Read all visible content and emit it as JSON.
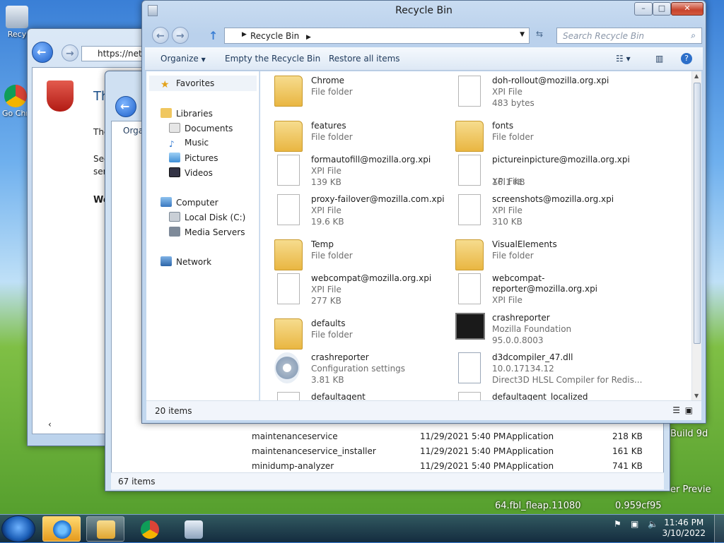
{
  "desktop": {
    "icons": [
      {
        "label": "Recy"
      },
      {
        "label": "Go Chr"
      }
    ],
    "overlay_texts": [
      "er Previe",
      "64.fbl_fleap.11080",
      "0.959cf95",
      "Build 9d"
    ]
  },
  "ie_window": {
    "address": "https://net",
    "heading": "The",
    "texts": [
      "The",
      "Sec",
      "serv",
      "We"
    ]
  },
  "explorer2": {
    "organize_label": "Orga",
    "rows": [
      {
        "name": "maintenanceservice",
        "date": "11/29/2021 5:40 PM",
        "type": "Application",
        "size": "218 KB"
      },
      {
        "name": "maintenanceservice_installer",
        "date": "11/29/2021 5:40 PM",
        "type": "Application",
        "size": "161 KB"
      },
      {
        "name": "minidump-analyzer",
        "date": "11/29/2021 5:40 PM",
        "type": "Application",
        "size": "741 KB"
      }
    ],
    "status": "67 items"
  },
  "recycle_bin": {
    "title": "Recycle Bin",
    "address": "Recycle Bin",
    "search_placeholder": "Search Recycle Bin",
    "toolbar": {
      "organize": "Organize",
      "empty": "Empty the Recycle Bin",
      "restore": "Restore all items"
    },
    "nav": {
      "favorites": "Favorites",
      "libraries": "Libraries",
      "documents": "Documents",
      "music": "Music",
      "pictures": "Pictures",
      "videos": "Videos",
      "computer": "Computer",
      "local_disk": "Local Disk (C:)",
      "media_servers": "Media Servers",
      "network": "Network"
    },
    "files": [
      {
        "name": "Chrome",
        "sub1": "File folder",
        "sub2": "",
        "icon": "folder-icon"
      },
      {
        "name": "doh-rollout@mozilla.org.xpi",
        "sub1": "XPI File",
        "sub2": "483 bytes",
        "icon": "document-icon"
      },
      {
        "name": "features",
        "sub1": "File folder",
        "sub2": "",
        "icon": "folder-icon"
      },
      {
        "name": "fonts",
        "sub1": "File folder",
        "sub2": "",
        "icon": "folder-icon"
      },
      {
        "name": "formautofill@mozilla.org.xpi",
        "sub1": "XPI File",
        "sub2": "139 KB",
        "icon": "document-icon"
      },
      {
        "name": "pictureinpicture@mozilla.org.xpi",
        "sub1": "XPI File",
        "sub2": "16.1 KB",
        "icon": "document-icon"
      },
      {
        "name": "proxy-failover@mozilla.com.xpi",
        "sub1": "XPI File",
        "sub2": "19.6 KB",
        "icon": "document-icon"
      },
      {
        "name": "screenshots@mozilla.org.xpi",
        "sub1": "XPI File",
        "sub2": "310 KB",
        "icon": "document-icon"
      },
      {
        "name": "Temp",
        "sub1": "File folder",
        "sub2": "",
        "icon": "folder-icon"
      },
      {
        "name": "VisualElements",
        "sub1": "File folder",
        "sub2": "",
        "icon": "folder-icon"
      },
      {
        "name": "webcompat@mozilla.org.xpi",
        "sub1": "XPI File",
        "sub2": "277 KB",
        "icon": "document-icon"
      },
      {
        "name": "webcompat-reporter@mozilla.org.xpi",
        "sub1": "XPI File",
        "sub2": "",
        "icon": "document-icon"
      },
      {
        "name": "defaults",
        "sub1": "File folder",
        "sub2": "",
        "icon": "folder-icon"
      },
      {
        "name": "crashreporter",
        "sub1": "Mozilla Foundation",
        "sub2": "95.0.0.8003",
        "icon": "crashreporter-icon"
      },
      {
        "name": "crashreporter",
        "sub1": "Configuration settings",
        "sub2": "3.81 KB",
        "icon": "config-icon"
      },
      {
        "name": "d3dcompiler_47.dll",
        "sub1": "10.0.17134.12",
        "sub2": "Direct3D HLSL Compiler for Redis...",
        "icon": "dll-icon"
      },
      {
        "name": "defaultagent",
        "sub1": "",
        "sub2": "",
        "icon": "document-icon"
      },
      {
        "name": "defaultagent_localized",
        "sub1": "",
        "sub2": "",
        "icon": "document-icon"
      }
    ],
    "status": "20 items"
  },
  "taskbar": {
    "time": "11:46 PM",
    "date": "3/10/2022"
  },
  "colors": {
    "accent": "#1e395b",
    "close_red": "#c7432b",
    "folder_yellow": "#e9b642"
  }
}
